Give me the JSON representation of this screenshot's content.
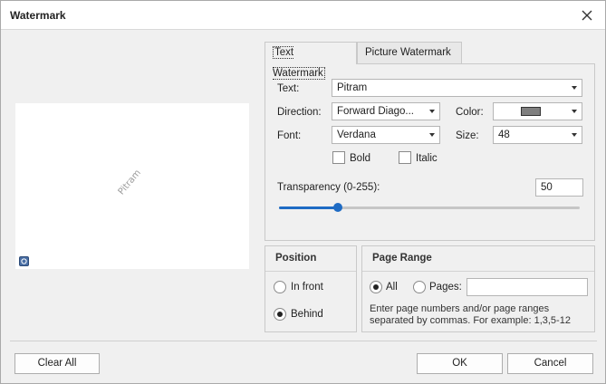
{
  "window": {
    "title": "Watermark"
  },
  "preview": {
    "watermark_text": "Pitram"
  },
  "tabs": [
    {
      "label": "Text Watermark",
      "active": true
    },
    {
      "label": "Picture Watermark",
      "active": false
    }
  ],
  "text_tab": {
    "text_label": "Text:",
    "text_value": "Pitram",
    "direction_label": "Direction:",
    "direction_value": "Forward Diago...",
    "color_label": "Color:",
    "color_value": "#7f7f7f",
    "font_label": "Font:",
    "font_value": "Verdana",
    "size_label": "Size:",
    "size_value": "48",
    "bold_label": "Bold",
    "bold_checked": false,
    "italic_label": "Italic",
    "italic_checked": false,
    "transparency_label": "Transparency (0-255):",
    "transparency_value": "50",
    "transparency_fraction": 0.196
  },
  "position": {
    "title": "Position",
    "in_front_label": "In front",
    "behind_label": "Behind",
    "selected": "Behind"
  },
  "page_range": {
    "title": "Page Range",
    "all_label": "All",
    "pages_label": "Pages:",
    "pages_value": "",
    "selected": "All",
    "hint": "Enter page numbers and/or page ranges separated by commas. For example: 1,3,5-12"
  },
  "buttons": {
    "clear_all": "Clear All",
    "ok": "OK",
    "cancel": "Cancel"
  },
  "colors": {
    "accent": "#1e6bc4",
    "dialog_bg": "#f0f0f0"
  }
}
